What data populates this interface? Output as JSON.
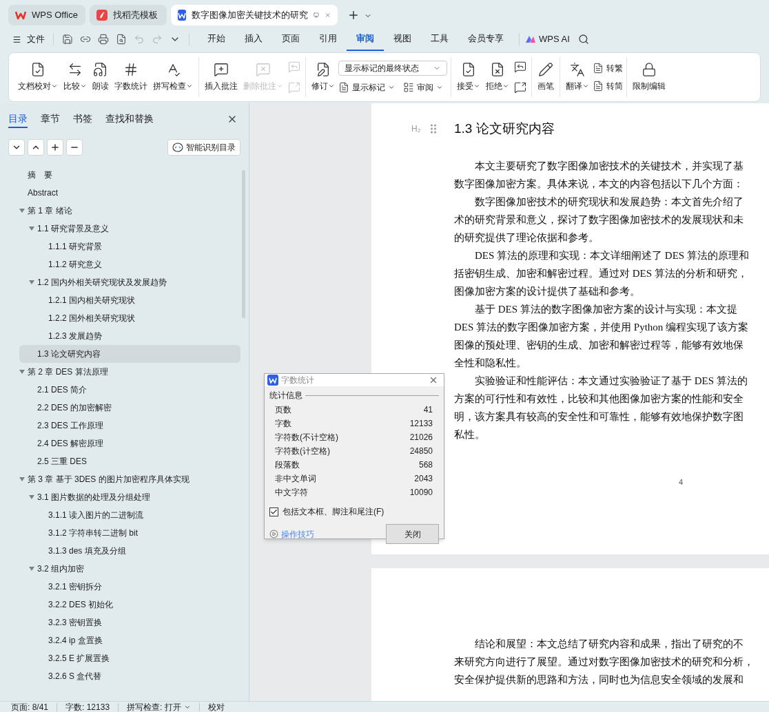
{
  "tabs": [
    {
      "label": "WPS Office",
      "kind": "home",
      "selected": false
    },
    {
      "label": "找稻壳模板",
      "kind": "template",
      "selected": false
    },
    {
      "label": "数字图像加密关键技术的研究",
      "kind": "document",
      "selected": true
    }
  ],
  "menu": {
    "file": "文件",
    "tabs": [
      {
        "label": "开始",
        "selected": false
      },
      {
        "label": "插入",
        "selected": false
      },
      {
        "label": "页面",
        "selected": false
      },
      {
        "label": "引用",
        "selected": false
      },
      {
        "label": "审阅",
        "selected": true
      },
      {
        "label": "视图",
        "selected": false
      },
      {
        "label": "工具",
        "selected": false
      },
      {
        "label": "会员专享",
        "selected": false
      }
    ],
    "ai": "WPS AI"
  },
  "ribbon": [
    {
      "items": [
        {
          "kind": "large",
          "label": "文档校对",
          "dropdown": true,
          "disabled": false
        },
        {
          "kind": "large",
          "label": "比较",
          "dropdown": true,
          "disabled": false
        },
        {
          "kind": "large",
          "label": "朗读",
          "dropdown": false,
          "disabled": false
        },
        {
          "kind": "large",
          "label": "字数统计",
          "dropdown": false,
          "disabled": false
        },
        {
          "kind": "large",
          "label": "拼写检查",
          "dropdown": true,
          "disabled": false
        }
      ]
    },
    {
      "items": [
        {
          "kind": "large",
          "label": "插入批注",
          "dropdown": false,
          "disabled": false
        },
        {
          "kind": "large",
          "label": "删除批注",
          "dropdown": true,
          "disabled": true
        },
        {
          "kind": "column",
          "rows": [
            {
              "kind": "icon",
              "disabled": true
            },
            {
              "kind": "icon",
              "disabled": true
            }
          ]
        }
      ]
    },
    {
      "items": [
        {
          "kind": "large",
          "label": "修订",
          "dropdown": true,
          "disabled": false
        },
        {
          "kind": "column",
          "rows": [
            {
              "kind": "select",
              "value": "显示标记的最终状态"
            },
            {
              "kind": "pair",
              "items": [
                {
                  "label": "显示标记",
                  "dropdown": true
                },
                {
                  "label": "审阅",
                  "dropdown": true
                }
              ]
            }
          ]
        }
      ]
    },
    {
      "items": [
        {
          "kind": "large",
          "label": "接受",
          "dropdown": true,
          "disabled": false
        },
        {
          "kind": "large",
          "label": "拒绝",
          "dropdown": true,
          "disabled": false
        },
        {
          "kind": "column",
          "rows": [
            {
              "kind": "icon",
              "disabled": false
            },
            {
              "kind": "icon",
              "disabled": false
            }
          ]
        }
      ]
    },
    {
      "items": [
        {
          "kind": "large",
          "label": "画笔",
          "dropdown": false,
          "disabled": false
        }
      ]
    },
    {
      "items": [
        {
          "kind": "large",
          "label": "翻译",
          "dropdown": true,
          "disabled": false
        },
        {
          "kind": "column",
          "rows": [
            {
              "kind": "small",
              "label": "转繁"
            },
            {
              "kind": "small",
              "label": "转简"
            }
          ]
        }
      ]
    },
    {
      "items": [
        {
          "kind": "large",
          "label": "限制编辑",
          "dropdown": false,
          "disabled": false
        }
      ]
    }
  ],
  "nav": {
    "tabs": [
      {
        "label": "目录",
        "selected": true
      },
      {
        "label": "章节",
        "selected": false
      },
      {
        "label": "书签",
        "selected": false
      },
      {
        "label": "查找和替换",
        "selected": false
      }
    ],
    "smart_button": "智能识别目录",
    "tree": [
      {
        "label": "摘　要",
        "selected": false
      },
      {
        "label": "Abstract",
        "selected": false
      },
      {
        "label": "第 1 章  绪论",
        "selected": false,
        "expanded": true,
        "children": [
          {
            "label": "1.1 研究背景及意义",
            "selected": false,
            "expanded": true,
            "children": [
              {
                "label": "1.1.1 研究背景",
                "selected": false
              },
              {
                "label": "1.1.2 研究意义",
                "selected": false
              }
            ]
          },
          {
            "label": "1.2 国内外相关研究现状及发展趋势",
            "selected": false,
            "expanded": true,
            "children": [
              {
                "label": "1.2.1 国内相关研究现状",
                "selected": false
              },
              {
                "label": "1.2.2 国外相关研究现状",
                "selected": false
              },
              {
                "label": "1.2.3 发展趋势",
                "selected": false
              }
            ]
          },
          {
            "label": "1.3 论文研究内容",
            "selected": true
          }
        ]
      },
      {
        "label": "第 2 章  DES 算法原理",
        "selected": false,
        "expanded": true,
        "children": [
          {
            "label": "2.1 DES 简介",
            "selected": false
          },
          {
            "label": "2.2 DES 的加密解密",
            "selected": false
          },
          {
            "label": "2.3 DES 工作原理",
            "selected": false
          },
          {
            "label": "2.4 DES 解密原理",
            "selected": false
          },
          {
            "label": "2.5 三重 DES",
            "selected": false
          }
        ]
      },
      {
        "label": "第 3 章  基于 3DES 的图片加密程序具体实现",
        "selected": false,
        "expanded": true,
        "children": [
          {
            "label": "3.1 图片数据的处理及分组处理",
            "selected": false,
            "expanded": true,
            "children": [
              {
                "label": "3.1.1 读入图片的二进制流",
                "selected": false
              },
              {
                "label": "3.1.2 字符串转二进制 bit",
                "selected": false
              },
              {
                "label": "3.1.3 des 填充及分组",
                "selected": false
              }
            ]
          },
          {
            "label": "3.2  组内加密",
            "selected": false,
            "expanded": true,
            "children": [
              {
                "label": "3.2.1  密钥拆分",
                "selected": false
              },
              {
                "label": "3.2.2 DES 初始化",
                "selected": false
              },
              {
                "label": "3.2.3  密钥置换",
                "selected": false
              },
              {
                "label": "3.2.4 ip 盒置换",
                "selected": false
              },
              {
                "label": "3.2.5 E 扩展置换",
                "selected": false
              },
              {
                "label": "3.2.6 S 盒代替",
                "selected": false
              }
            ]
          }
        ]
      }
    ]
  },
  "document": {
    "heading_marker": "H₂",
    "heading": "1.3 论文研究内容",
    "page1_lines": [
      {
        "text": "本文主要研究了数字图像加密技术的关键技术，并实现了基",
        "indent": true
      },
      {
        "text": "数字图像加密方案。具体来说，本文的内容包括以下几个方面：",
        "indent": false
      },
      {
        "text": "数字图像加密技术的研究现状和发展趋势：本文首先介绍了",
        "indent": true
      },
      {
        "text": "术的研究背景和意义，探讨了数字图像加密技术的发展现状和未",
        "indent": false
      },
      {
        "text": "的研究提供了理论依据和参考。",
        "indent": false
      },
      {
        "text": "DES 算法的原理和实现：本文详细阐述了 DES 算法的原理和",
        "indent": true
      },
      {
        "text": "括密钥生成、加密和解密过程。通过对 DES 算法的分析和研究，",
        "indent": false
      },
      {
        "text": "图像加密方案的设计提供了基础和参考。",
        "indent": false
      },
      {
        "text": "基于 DES 算法的数字图像加密方案的设计与实现：本文提",
        "indent": true
      },
      {
        "text": "DES 算法的数字图像加密方案，并使用 Python 编程实现了该方案",
        "indent": false
      },
      {
        "text": "图像的预处理、密钥的生成、加密和解密过程等，能够有效地保",
        "indent": false
      },
      {
        "text": "全性和隐私性。",
        "indent": false
      },
      {
        "text": "实验验证和性能评估：本文通过实验验证了基于 DES 算法的",
        "indent": true
      },
      {
        "text": "方案的可行性和有效性，比较和其他图像加密方案的性能和安全",
        "indent": false
      },
      {
        "text": "明，该方案具有较高的安全性和可靠性，能够有效地保护数字图",
        "indent": false
      },
      {
        "text": "私性。",
        "indent": false
      }
    ],
    "page_number": "4",
    "page2_lines": [
      {
        "text": "结论和展望：本文总结了研究内容和成果，指出了研究的不",
        "indent": true
      },
      {
        "text": "来研究方向进行了展望。通过对数字图像加密技术的研究和分析，",
        "indent": false
      },
      {
        "text": "安全保护提供新的思路和方法，同时也为信息安全领域的发展和",
        "indent": false
      }
    ]
  },
  "dialog": {
    "title": "字数统计",
    "group": "统计信息",
    "stats": [
      {
        "label": "页数",
        "value": "41"
      },
      {
        "label": "字数",
        "value": "12133"
      },
      {
        "label": "字符数(不计空格)",
        "value": "21026"
      },
      {
        "label": "字符数(计空格)",
        "value": "24850"
      },
      {
        "label": "段落数",
        "value": "568"
      },
      {
        "label": "非中文单词",
        "value": "2043"
      },
      {
        "label": "中文字符",
        "value": "10090"
      }
    ],
    "checkbox": {
      "label": "包括文本框、脚注和尾注(F)",
      "checked": true
    },
    "tips": "操作技巧",
    "close": "关闭"
  },
  "status_bar": [
    {
      "label": "页面: 8/41",
      "dropdown": false
    },
    {
      "label": "字数: 12133",
      "dropdown": false
    },
    {
      "label": "拼写检查: 打开",
      "dropdown": true
    },
    {
      "label": "校对",
      "dropdown": false
    }
  ]
}
